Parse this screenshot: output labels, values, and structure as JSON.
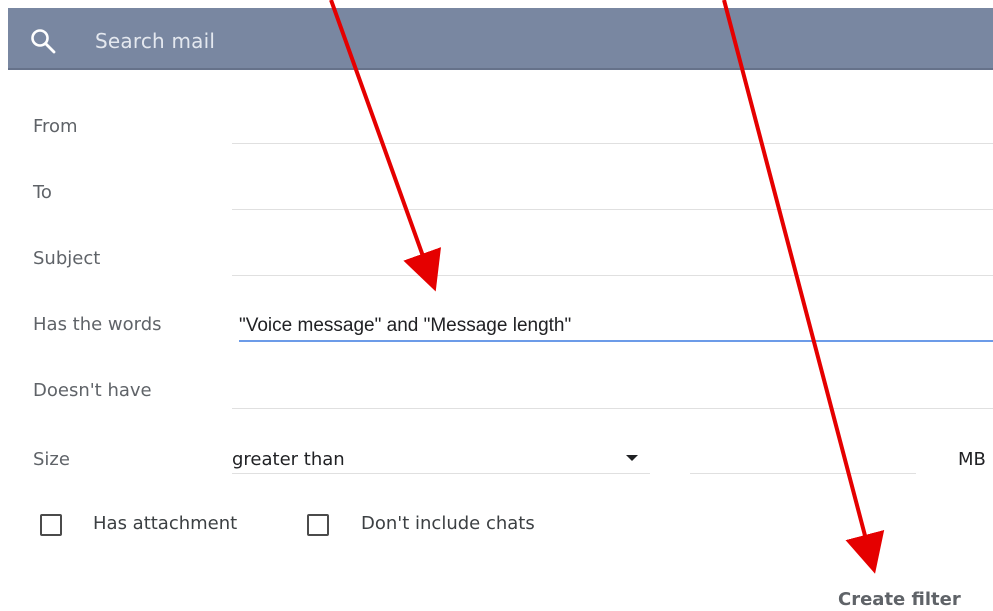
{
  "search": {
    "placeholder": "Search mail"
  },
  "form": {
    "from": {
      "label": "From",
      "value": ""
    },
    "to": {
      "label": "To",
      "value": ""
    },
    "subject": {
      "label": "Subject",
      "value": ""
    },
    "has_words": {
      "label": "Has the words",
      "value": "\"Voice message\" and \"Message length\""
    },
    "doesnt_have": {
      "label": "Doesn't have",
      "value": ""
    },
    "size": {
      "label": "Size",
      "comparator": "greater than",
      "value": "",
      "unit": "MB"
    }
  },
  "options": {
    "has_attachment": {
      "label": "Has attachment",
      "checked": false
    },
    "dont_include_chats": {
      "label": "Don't include chats",
      "checked": false
    }
  },
  "actions": {
    "create_filter": "Create filter"
  },
  "annotations": {
    "arrow_color": "#e50000"
  },
  "colors": {
    "search_bar": "#7987a1",
    "focus_underline": "#6c9be8"
  }
}
